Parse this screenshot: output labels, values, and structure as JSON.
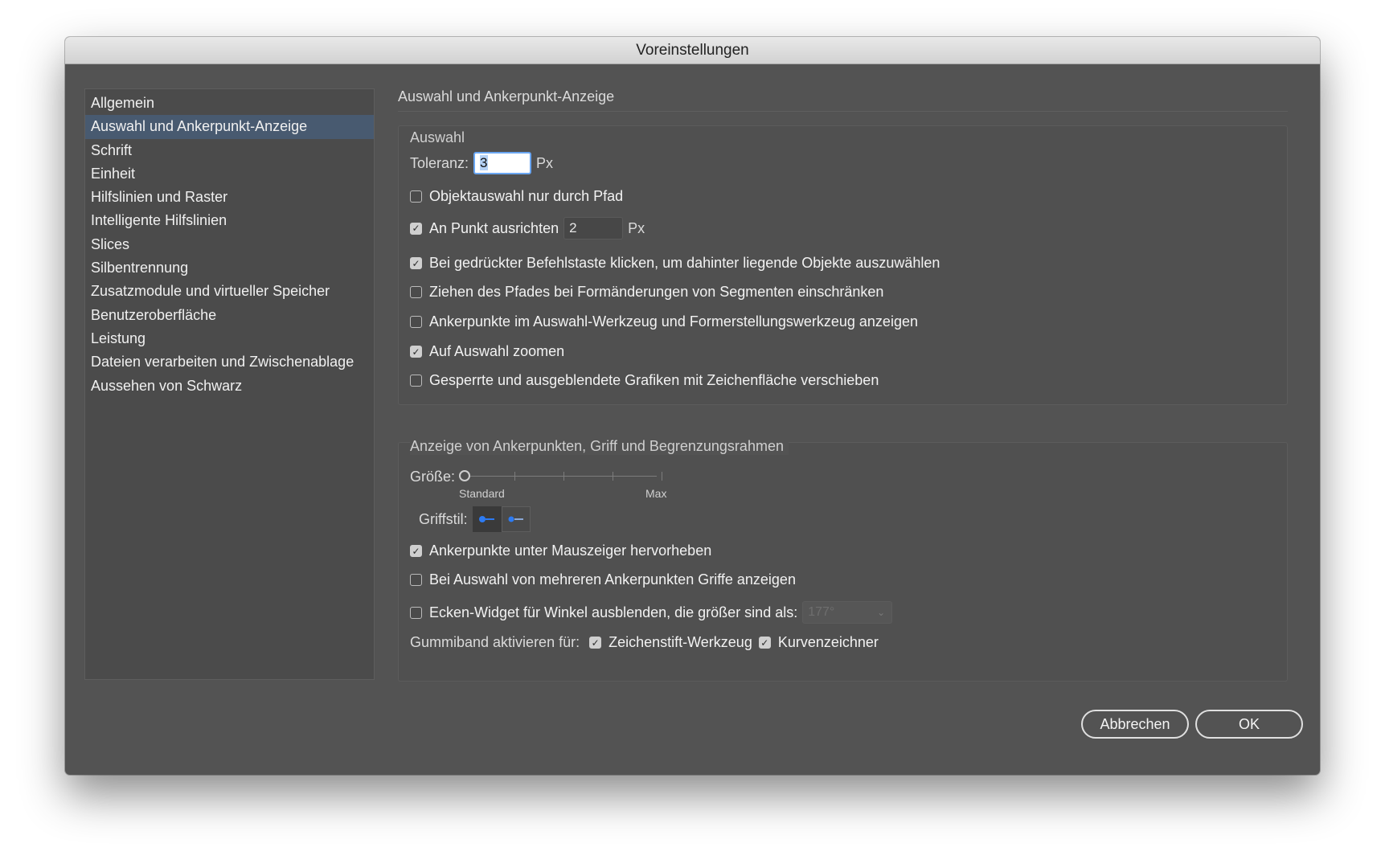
{
  "window": {
    "title": "Voreinstellungen"
  },
  "sidebar": {
    "items": [
      {
        "label": "Allgemein"
      },
      {
        "label": "Auswahl und Ankerpunkt-Anzeige",
        "active": true
      },
      {
        "label": "Schrift"
      },
      {
        "label": "Einheit"
      },
      {
        "label": "Hilfslinien und Raster"
      },
      {
        "label": "Intelligente Hilfslinien"
      },
      {
        "label": "Slices"
      },
      {
        "label": "Silbentrennung"
      },
      {
        "label": "Zusatzmodule und virtueller Speicher"
      },
      {
        "label": "Benutzeroberfläche"
      },
      {
        "label": "Leistung"
      },
      {
        "label": "Dateien verarbeiten und Zwischenablage"
      },
      {
        "label": "Aussehen von Schwarz"
      }
    ]
  },
  "main": {
    "section_title": "Auswahl und Ankerpunkt-Anzeige",
    "auswahl": {
      "group_label": "Auswahl",
      "toleranz_label": "Toleranz:",
      "toleranz_value": "3",
      "toleranz_unit": "Px",
      "objektauswahl": {
        "label": "Objektauswahl nur durch Pfad",
        "checked": false
      },
      "an_punkt": {
        "label": "An Punkt ausrichten",
        "checked": true,
        "value": "2",
        "unit": "Px"
      },
      "befehlstaste": {
        "label": "Bei gedrückter Befehlstaste klicken, um dahinter liegende Objekte auszuwählen",
        "checked": true
      },
      "ziehen": {
        "label": "Ziehen des Pfades bei Formänderungen von Segmenten einschränken",
        "checked": false
      },
      "ankerpunkte_werkzeug": {
        "label": "Ankerpunkte im Auswahl-Werkzeug und Formerstellungswerkzeug anzeigen",
        "checked": false
      },
      "zoomen": {
        "label": "Auf Auswahl zoomen",
        "checked": true
      },
      "gesperrte": {
        "label": "Gesperrte und ausgeblendete Grafiken mit Zeichenfläche verschieben",
        "checked": false
      }
    },
    "anzeige": {
      "group_label": "Anzeige von Ankerpunkten, Griff und Begrenzungsrahmen",
      "groesse_label": "Größe:",
      "slider_min_label": "Standard",
      "slider_max_label": "Max",
      "slider_value": 0,
      "griffstil_label": "Griffstil:",
      "hervorheben": {
        "label": "Ankerpunkte unter Mauszeiger hervorheben",
        "checked": true
      },
      "griffe": {
        "label": "Bei Auswahl von mehreren Ankerpunkten Griffe anzeigen",
        "checked": false
      },
      "ecken": {
        "label": "Ecken-Widget für Winkel ausblenden, die größer sind als:",
        "checked": false,
        "value": "177°"
      },
      "gummiband_label": "Gummiband aktivieren für:",
      "zeichenstift": {
        "label": "Zeichenstift-Werkzeug",
        "checked": true
      },
      "kurvenzeichner": {
        "label": "Kurvenzeichner",
        "checked": true
      }
    }
  },
  "buttons": {
    "cancel": "Abbrechen",
    "ok": "OK"
  },
  "colors": {
    "accent_blue": "#2d7bf3",
    "selection_bg": "#485a70"
  }
}
